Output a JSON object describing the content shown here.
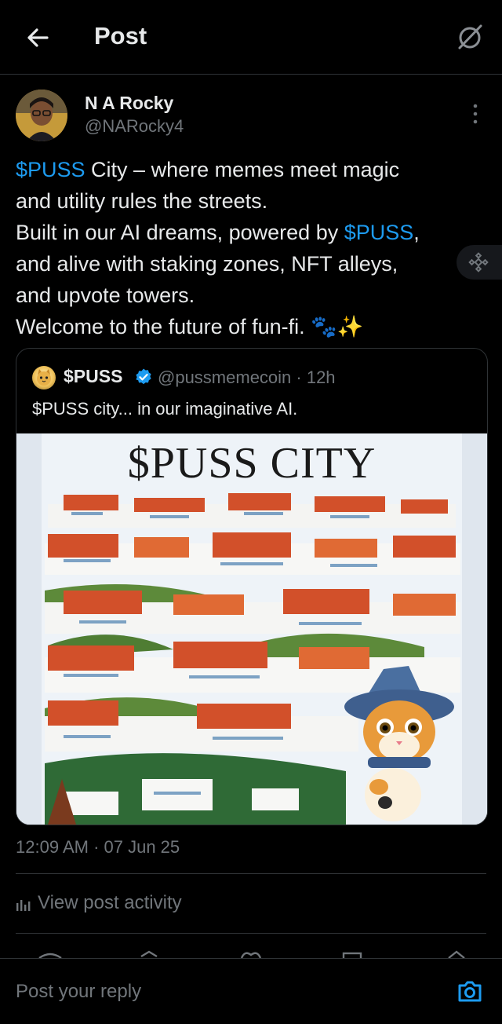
{
  "header": {
    "title": "Post"
  },
  "author": {
    "name": "N A Rocky",
    "handle": "@NARocky4"
  },
  "post": {
    "line1_link": "$PUSS",
    "line1_rest": " City – where memes meet magic",
    "line2": "and utility rules the streets.",
    "line3_start": "Built in our AI dreams, powered by ",
    "line3_link": "$PUSS",
    "line3_end": ",",
    "line4": "and alive with staking zones, NFT alleys,",
    "line5": "and upvote towers.",
    "line6": "Welcome to the future of fun-fi. 🐾✨",
    "timestamp": "12:09 AM · 07 Jun 25",
    "activity_label": "View post activity"
  },
  "quoted": {
    "name": "$PUSS",
    "handle_time": "@pussmemecoin · 12h",
    "text": "$PUSS city... in our imaginative AI.",
    "image_title": "$PUSS CITY"
  },
  "reply": {
    "placeholder": "Post your reply"
  },
  "colors": {
    "accent": "#1d9bf0",
    "background": "#000000",
    "muted": "#71767b",
    "text": "#e7e9ea"
  },
  "icons": [
    "back-arrow-icon",
    "grok-icon",
    "more-vertical-icon",
    "binance-icon",
    "verified-badge-icon",
    "activity-bars-icon",
    "camera-icon"
  ]
}
